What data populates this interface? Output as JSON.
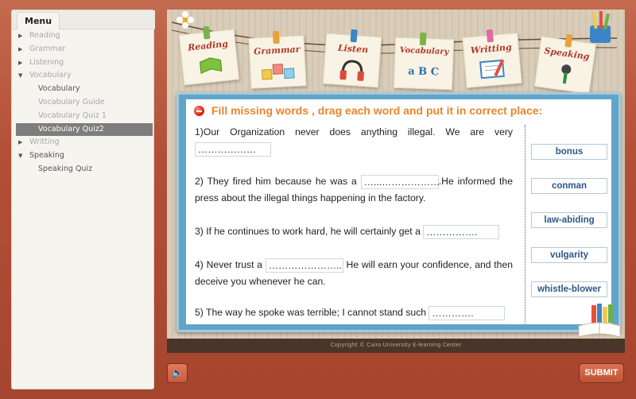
{
  "sidebar": {
    "menu_label": "Menu",
    "items": [
      {
        "label": "Reading",
        "expanded": false
      },
      {
        "label": "Grammar",
        "expanded": false
      },
      {
        "label": "Listening",
        "expanded": false
      },
      {
        "label": "Vocabulary",
        "expanded": true
      },
      {
        "label": "Vocabulary"
      },
      {
        "label": "Vocabulary Guide"
      },
      {
        "label": "Vocabulary Quiz 1"
      },
      {
        "label": "Vocabulary Quiz2",
        "active": true
      },
      {
        "label": "Writting",
        "expanded": false
      },
      {
        "label": "Speaking",
        "expanded": true
      },
      {
        "label": "Speaking Quiz"
      }
    ]
  },
  "header_cards": [
    {
      "label": "Reading",
      "icon": "book-icon"
    },
    {
      "label": "Grammar",
      "icon": "letter-blocks-icon"
    },
    {
      "label": "Listen",
      "icon": "headphones-icon"
    },
    {
      "label": "Vocabulary",
      "sub": "a B C",
      "icon": "abc-icon"
    },
    {
      "label": "Writting",
      "icon": "notebook-icon"
    },
    {
      "label": "Speaking",
      "icon": "microphone-icon"
    }
  ],
  "quiz": {
    "instruction": "Fill missing words ,  drag each word and put it in correct place:",
    "questions": [
      {
        "before": "1)Our Organization never does anything illegal. We are very",
        "blank": "………………",
        "after": ""
      },
      {
        "before": "2) They fired him because he was a",
        "blank": "…...………………",
        "after": ".He informed the press about the illegal things happening in the factory."
      },
      {
        "before": "3) If he continues to work hard, he will certainly get a",
        "blank": "…………….",
        "after": ""
      },
      {
        "before": "4)  Never trust a",
        "blank": "…………………..",
        "after": " He will earn your confidence, and then deceive you whenever he can."
      },
      {
        "before": "5) The way he spoke was terrible; I cannot stand such",
        "blank": "………….",
        "after": ""
      }
    ],
    "words": [
      "bonus",
      "conman",
      "law-abiding",
      "vulgarity",
      "whistle-blower"
    ]
  },
  "footer": {
    "copyright": "Copyright © Cairo University E-learning Center",
    "submit_label": "SUBMIT",
    "audio_icon": "speaker-icon"
  },
  "colors": {
    "frame": "#b8553c",
    "board": "#5fa5c9",
    "instruction": "#e6862e",
    "word_text": "#2b5886",
    "active_menu": "#7d7d7d"
  }
}
